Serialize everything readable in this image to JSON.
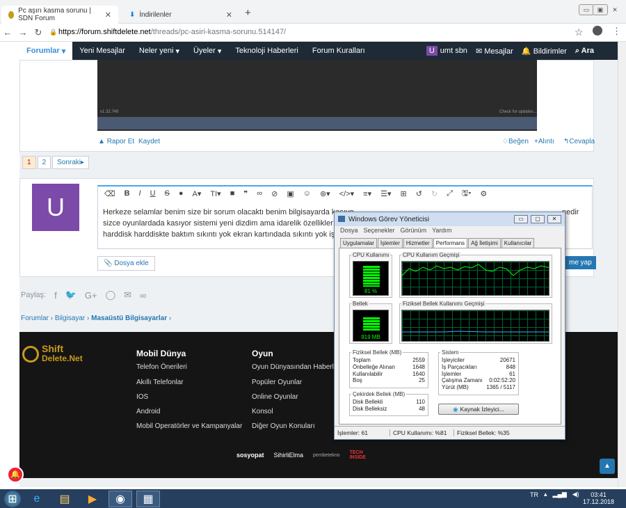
{
  "browser": {
    "tabs": [
      {
        "title": "Pc aşırı kasma sorunu | SDN Forum"
      },
      {
        "title": "İndirilenler"
      }
    ],
    "url_host": "https://forum.shiftdelete.net",
    "url_path": "/threads/pc-asiri-kasma-sorunu.514147/"
  },
  "nav": {
    "items": [
      "Forumlar",
      "Yeni Mesajlar",
      "Neler yeni",
      "Üyeler",
      "Teknoloji Haberleri",
      "Forum Kuralları"
    ],
    "user_initial": "U",
    "user": "umt sbn",
    "messages": "Mesajlar",
    "notifications": "Bildirimler",
    "search": "Ara"
  },
  "post": {
    "video_left_caption": "v1.32.749",
    "video_right_caption": "Check for updates...",
    "report": "Rapor Et",
    "save": "Kaydet",
    "like": "Beğen",
    "quote": "Alıntı",
    "reply": "Cevapla"
  },
  "pager": {
    "pages": [
      "1",
      "2"
    ],
    "next": "Sonraki"
  },
  "editor": {
    "avatar_initial": "U",
    "text": "Herkeze selamlar benim size bir sorum olacaktı benim bilgisayarda kasıyo ... sizce oyunlardada kasıyor sistemi yeni dizdim ama idarelik özellikler şun ... harddisk harddiskte baktım sıkıntı yok ekran kartındada sıkıntı yok işlem",
    "line1": "Herkeze selamlar benim size bir sorum olacaktı benim bilgisayarda kasıyo",
    "line1_end": "nedir",
    "line2": "sizce oyunlardada kasıyor sistemi yeni dizdim ama idarelik özellikler şun",
    "line3": "harddisk harddiskte baktım sıkıntı yok ekran kartındada sıkıntı yok işlem",
    "attach": "Dosya ekle",
    "submit": "me yap"
  },
  "share": {
    "label": "Paylaş:"
  },
  "breadcrumb": [
    "Forumlar",
    "Bilgisayar",
    "Masaüstü Bilgisayarlar"
  ],
  "footer": {
    "col1_title": "Mobil Dünya",
    "col1": [
      "Telefon Önerileri",
      "Akıllı Telefonlar",
      "IOS",
      "Android",
      "Mobil Operatörler ve Kampanyalar"
    ],
    "col2_title": "Oyun",
    "col2": [
      "Oyun Dünyasından Haberler",
      "Popüler Oyunlar",
      "Online Oyunlar",
      "Konsol",
      "Diğer Oyun Konuları"
    ],
    "logo_top": "Shift",
    "logo_bottom": "Delete.Net",
    "partners": [
      "sosyopat",
      "SihirliElma",
      "pembetekno",
      "TECH INSIDE"
    ]
  },
  "taskmanager": {
    "title": "Windows Görev Yöneticisi",
    "menu": [
      "Dosya",
      "Seçenekler",
      "Görünüm",
      "Yardım"
    ],
    "tabs": [
      "Uygulamalar",
      "İşlemler",
      "Hizmetler",
      "Performans",
      "Ağ İletişimi",
      "Kullanıcılar"
    ],
    "cpu_label": "CPU Kullanımı",
    "cpu_value": "81 %",
    "cpu_history": "CPU Kullanım Geçmişi",
    "mem_label": "Bellek",
    "mem_value": "919 MB",
    "mem_history": "Fiziksel Bellek Kullanımı Geçmişi",
    "physmem_title": "Fiziksel Bellek (MB)",
    "physmem": [
      [
        "Toplam",
        "2559"
      ],
      [
        "Önbelleğe Alınan",
        "1648"
      ],
      [
        "Kullanılabilir",
        "1640"
      ],
      [
        "Boş",
        "25"
      ]
    ],
    "kernel_title": "Çekirdek Bellek (MB)",
    "kernel": [
      [
        "Disk Bellekli",
        "110"
      ],
      [
        "Disk Belleksiz",
        "48"
      ]
    ],
    "system_title": "Sistem",
    "system": [
      [
        "İşleyiciler",
        "20671"
      ],
      [
        "İş Parçacıkları",
        "848"
      ],
      [
        "İşlemler",
        "61"
      ],
      [
        "Çalışma Zamanı",
        "0:02:52:20"
      ],
      [
        "Yürüt (MB)",
        "1365 / 5117"
      ]
    ],
    "resource_btn": "Kaynak İzleyici...",
    "status_proc": "İşlemler: 61",
    "status_cpu": "CPU Kullanımı: %81",
    "status_mem": "Fiziksel Bellek: %35"
  },
  "taskbar": {
    "lang": "TR",
    "time": "03:41",
    "date": "17.12.2018"
  }
}
